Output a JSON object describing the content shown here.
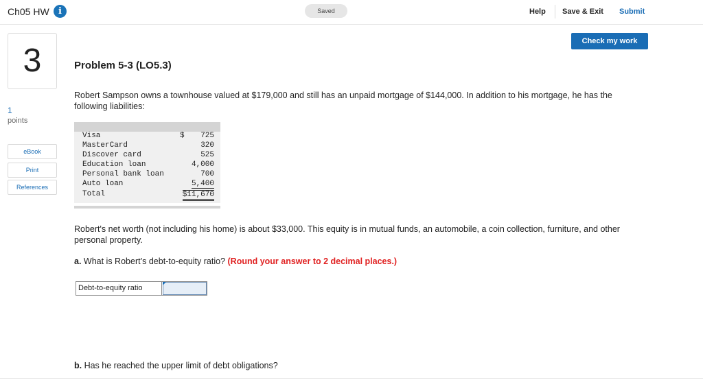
{
  "header": {
    "title": "Ch05 HW",
    "info_icon": "i",
    "saved_label": "Saved",
    "help_label": "Help",
    "save_exit_label": "Save & Exit",
    "submit_label": "Submit"
  },
  "question": {
    "number": "3",
    "points_value": "1",
    "points_label": "points"
  },
  "sidebar": {
    "ebook_label": "eBook",
    "print_label": "Print",
    "references_label": "References"
  },
  "check_button_label": "Check my work",
  "problem": {
    "title": "Problem 5-3 (LO5.3)",
    "intro": "Robert Sampson owns a townhouse valued at $179,000 and still has an unpaid mortgage of $144,000. In addition to his mortgage, he has the following liabilities:",
    "liabilities": [
      {
        "name": "Visa",
        "dollar": "$",
        "amount": "725"
      },
      {
        "name": "MasterCard",
        "dollar": "",
        "amount": "320"
      },
      {
        "name": "Discover card",
        "dollar": "",
        "amount": "525"
      },
      {
        "name": "Education loan",
        "dollar": "",
        "amount": "4,000"
      },
      {
        "name": "Personal bank loan",
        "dollar": "",
        "amount": "700"
      },
      {
        "name": "Auto loan",
        "dollar": "",
        "amount": "5,400"
      }
    ],
    "total_label": "Total",
    "total_amount": "$11,670",
    "networth": "Robert's net worth (not including his home) is about $33,000. This equity is in mutual funds, an automobile, a coin collection, furniture, and other personal property.",
    "question_a_prefix": "a.",
    "question_a_text": " What is Robert’s debt-to-equity ratio? ",
    "question_a_note": "(Round your answer to 2 decimal places.)",
    "answer_label": "Debt-to-equity ratio",
    "answer_value": "",
    "question_b_prefix": "b.",
    "question_b_text": " Has he reached the upper limit of debt obligations?"
  }
}
